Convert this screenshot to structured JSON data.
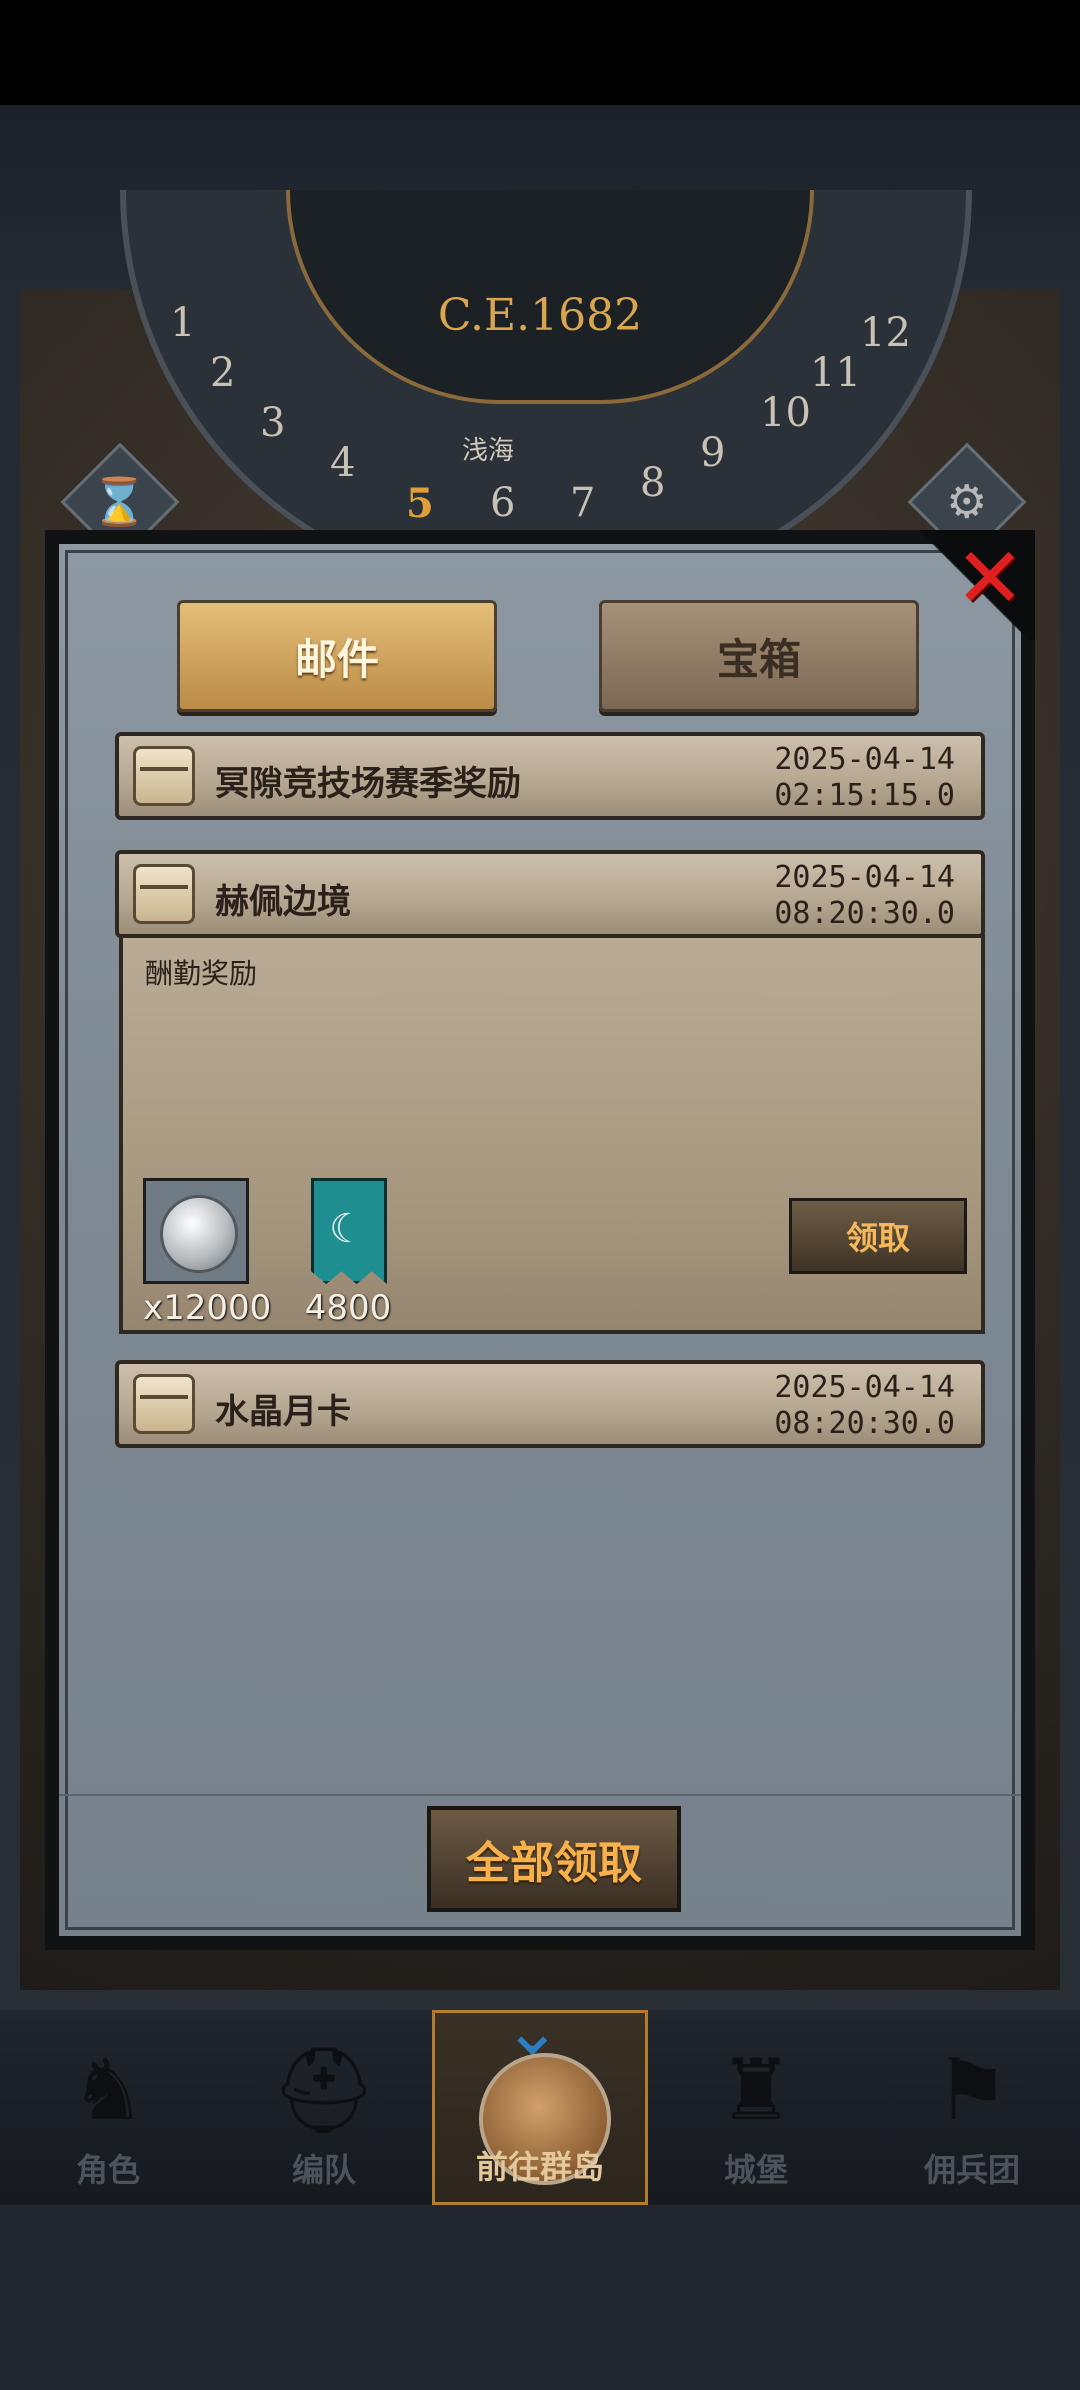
{
  "header": {
    "era": "C.E.1682",
    "region_label": "浅海",
    "dial_numbers": [
      "1",
      "2",
      "3",
      "4",
      "5",
      "6",
      "7",
      "8",
      "9",
      "10",
      "11",
      "12"
    ],
    "current_month": "5"
  },
  "modal": {
    "tabs": [
      {
        "label": "邮件",
        "active": true
      },
      {
        "label": "宝箱",
        "active": false
      }
    ],
    "mails": [
      {
        "title": "冥隙竞技场赛季奖励",
        "date": "2025-04-14",
        "time": "02:15:15.0"
      },
      {
        "title": "赫佩边境",
        "date": "2025-04-14",
        "time": "08:20:30.0"
      },
      {
        "title": "水晶月卡",
        "date": "2025-04-14",
        "time": "08:20:30.0"
      }
    ],
    "expanded": {
      "body_label": "酬勤奖励",
      "rewards": [
        {
          "icon": "silver-coin-icon",
          "qty": "x12000"
        },
        {
          "icon": "crescent-banner-icon",
          "qty": "4800"
        }
      ],
      "claim_label": "领取"
    },
    "claim_all_label": "全部领取"
  },
  "nav": {
    "items": [
      {
        "label": "角色",
        "icon": "knight-icon"
      },
      {
        "label": "编队",
        "icon": "helmet-icon"
      },
      {
        "label": "前往群岛",
        "icon": "globe-icon",
        "active": true
      },
      {
        "label": "城堡",
        "icon": "castle-icon"
      },
      {
        "label": "佣兵团",
        "icon": "mercenary-icon"
      }
    ]
  },
  "colors": {
    "accent": "#e0a037",
    "close": "#e02020",
    "claim_text": "#f5b85a"
  }
}
